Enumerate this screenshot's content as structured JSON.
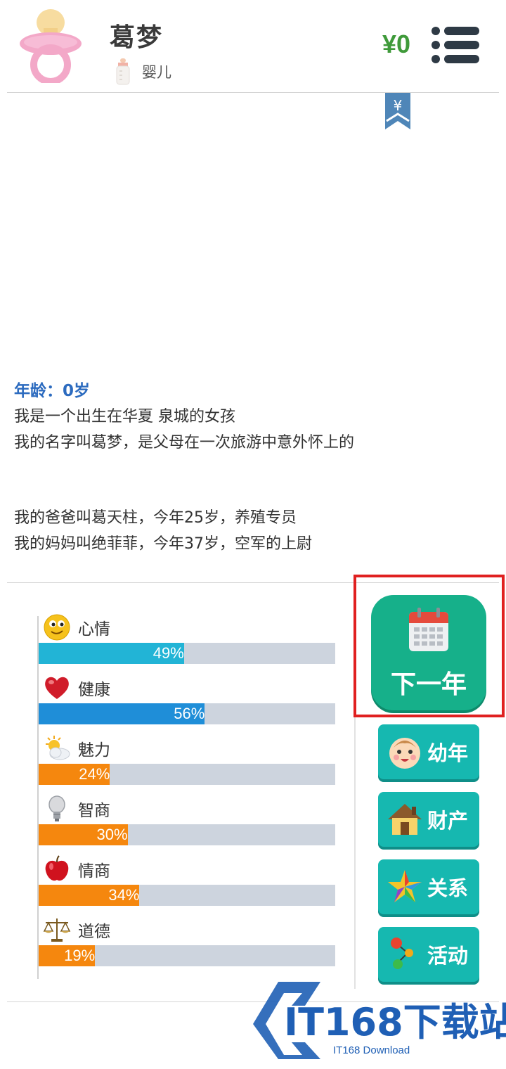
{
  "header": {
    "name": "葛梦",
    "stage": "婴儿",
    "money": "¥0",
    "avatar_icon": "pacifier-icon",
    "stage_icon": "baby-bottle-icon",
    "menu_icon": "menu-icon"
  },
  "bookmark": {
    "symbol": "¥"
  },
  "story": {
    "age": "年龄：0岁",
    "lines": [
      "我是一个出生在华夏 泉城的女孩",
      "我的名字叫葛梦，是父母在一次旅游中意外怀上的",
      "我的爸爸叫葛天柱，今年25岁，养殖专员",
      "我的妈妈叫绝菲菲，今年37岁，空军的上尉"
    ]
  },
  "stats": [
    {
      "label": "心情",
      "value": 49,
      "text": "49%",
      "color": "#22b4d6",
      "icon": "smiley-icon"
    },
    {
      "label": "健康",
      "value": 56,
      "text": "56%",
      "color": "#1f8ed8",
      "icon": "heart-icon"
    },
    {
      "label": "魅力",
      "value": 24,
      "text": "24%",
      "color": "#f5870e",
      "icon": "sun-cloud-icon"
    },
    {
      "label": "智商",
      "value": 30,
      "text": "30%",
      "color": "#f5870e",
      "icon": "lightbulb-icon"
    },
    {
      "label": "情商",
      "value": 34,
      "text": "34%",
      "color": "#f5870e",
      "icon": "apple-icon"
    },
    {
      "label": "道德",
      "value": 19,
      "text": "19%",
      "color": "#f5870e",
      "icon": "scales-icon"
    }
  ],
  "actions": {
    "next_year": "下一年",
    "buttons": [
      {
        "label": "幼年",
        "icon": "baby-face-icon"
      },
      {
        "label": "财产",
        "icon": "house-icon"
      },
      {
        "label": "关系",
        "icon": "star-icon"
      },
      {
        "label": "活动",
        "icon": "activity-icon"
      }
    ]
  },
  "colors": {
    "money": "#3f9a3a",
    "age": "#2c6bbf",
    "next_button": "#16b08a",
    "side_button": "#16b8b0",
    "bar_track": "#cdd4de",
    "highlight": "#e02020"
  },
  "watermark": {
    "brand": "IT168下载站",
    "sub": "IT168 Download"
  }
}
